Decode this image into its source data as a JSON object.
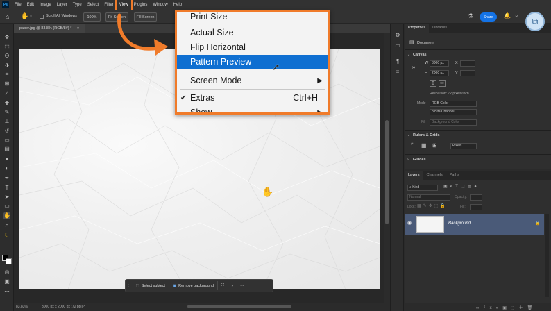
{
  "menubar": {
    "logo": "Ps",
    "items": [
      "File",
      "Edit",
      "Image",
      "Layer",
      "Type",
      "Select",
      "Filter",
      "View",
      "Plugins",
      "Window",
      "Help"
    ]
  },
  "options": {
    "scroll_all": "Scroll All Windows",
    "zoom_100": "100%",
    "fit_screen": "Fit Screen",
    "fill_screen": "Fill Screen",
    "share": "Share"
  },
  "document_tab": {
    "label": "paper.jpg @ 83.8% (RGB/8#) *"
  },
  "status": {
    "zoom": "83.83%",
    "info": "3000 px x 2000 px (72 ppi)"
  },
  "view_menu": {
    "items": [
      {
        "label": "Print Size"
      },
      {
        "label": "Actual Size"
      },
      {
        "label": "Flip Horizontal"
      },
      {
        "label": "Pattern Preview"
      },
      {
        "label": "Screen Mode"
      },
      {
        "label": "Extras",
        "shortcut": "Ctrl+H"
      },
      {
        "label": "Show"
      }
    ]
  },
  "taskbar": {
    "select_subject": "Select subject",
    "remove_background": "Remove background",
    "more": "···"
  },
  "properties": {
    "tabs": [
      "Properties",
      "Libraries"
    ],
    "doc_label": "Document",
    "canvas_title": "Canvas",
    "w_label": "W",
    "w_value": "3000 px",
    "h_label": "H",
    "h_value": "2000 px",
    "x_label": "X",
    "y_label": "Y",
    "resolution": "Resolution: 72 pixels/inch",
    "mode_label": "Mode",
    "mode_value": "RGB Color",
    "depth_value": "8 Bits/Channel",
    "fill_label": "Fill",
    "fill_value": "Background Color",
    "rulers_title": "Rulers & Grids",
    "units_value": "Pixels",
    "guides_title": "Guides"
  },
  "layers": {
    "tabs": [
      "Layers",
      "Channels",
      "Paths"
    ],
    "kind": "Kind",
    "blend": "Normal",
    "opacity_label": "Opacity:",
    "lock_label": "Lock:",
    "fill_label": "Fill:",
    "layer_name": "Background"
  }
}
